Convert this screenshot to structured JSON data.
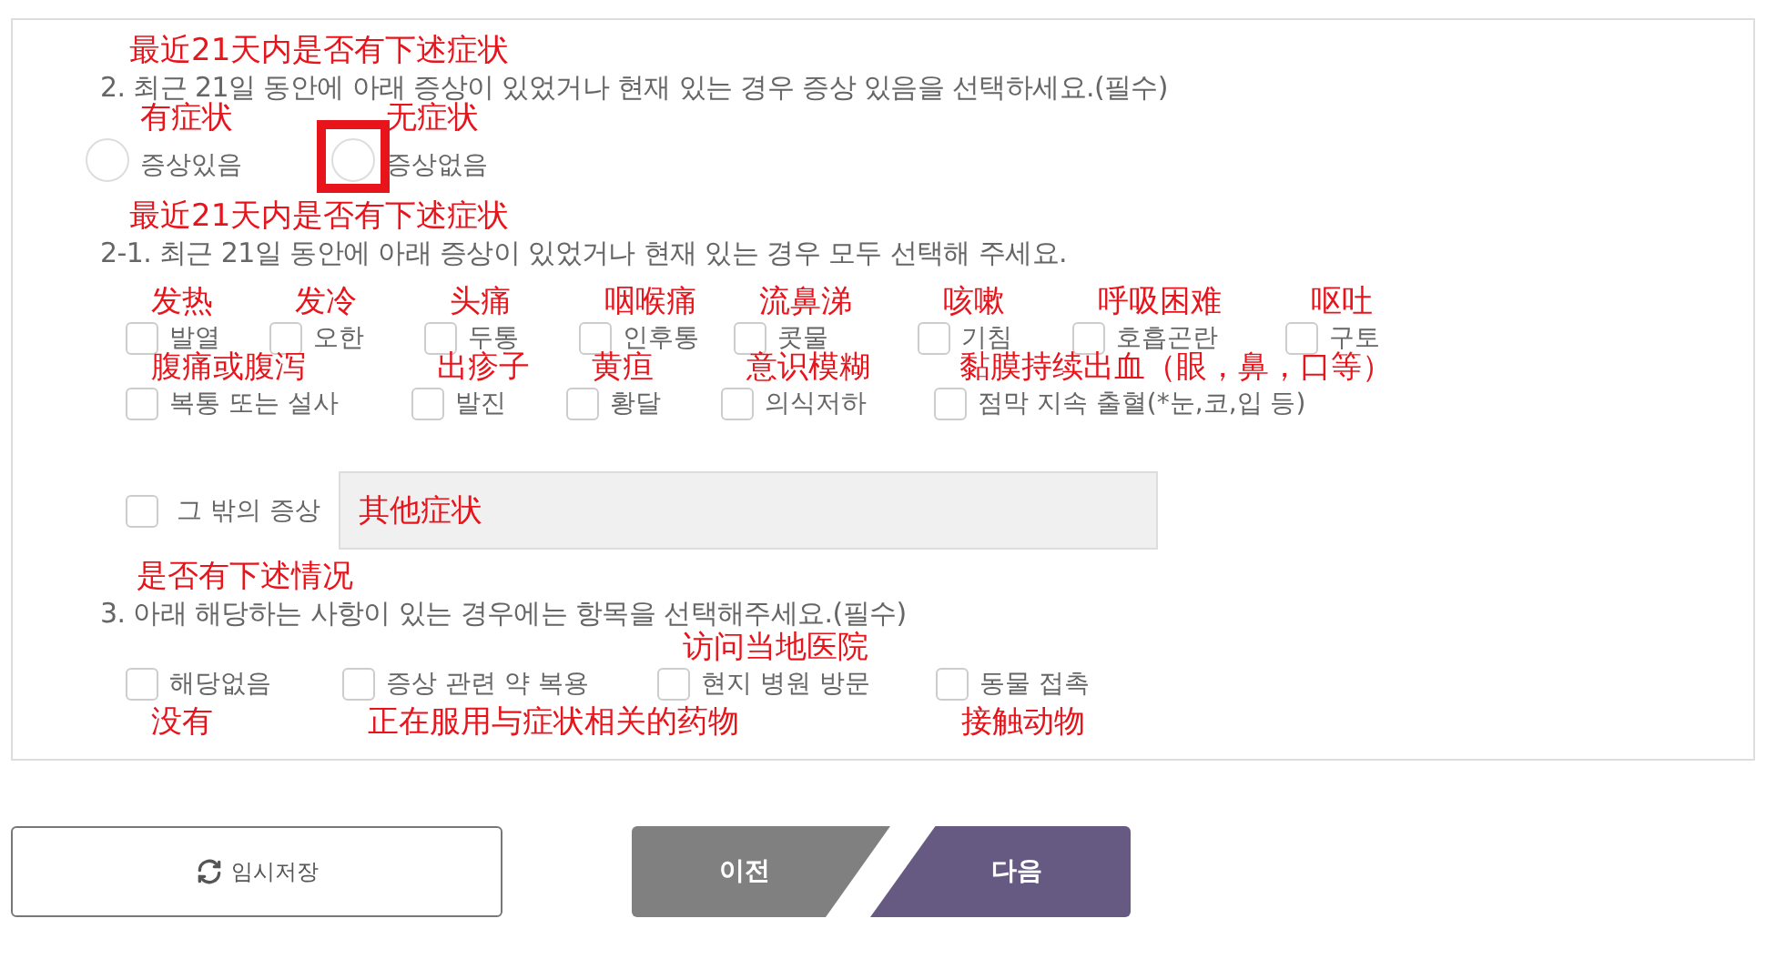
{
  "questions": [
    {
      "kind": "radio",
      "title": "2. 최근 21일 동안에 아래 증상이 있었거나 현재 있는 경우 증상 있음을 선택하세요.(필수)",
      "note": "最近21天内是否有下述症状",
      "lines": [
        {
          "options": [
            {
              "label": "증상있음",
              "note": "有症状",
              "selected": false,
              "highlighted": false
            },
            {
              "label": "증상없음",
              "note": "无症状",
              "selected": false,
              "highlighted": true
            }
          ]
        }
      ]
    },
    {
      "kind": "checkbox",
      "title": "2-1. 최근 21일 동안에 아래 증상이 있었거나 현재 있는 경우 모두 선택해 주세요.",
      "note": "最近21天内是否有下述症状",
      "lines": [
        {
          "options": [
            {
              "label": "발열",
              "note": "发热",
              "checked": false
            },
            {
              "label": "오한",
              "note": "发冷",
              "checked": false
            },
            {
              "label": "두통",
              "note": "头痛",
              "checked": false
            },
            {
              "label": "인후통",
              "note": "咽喉痛",
              "checked": false
            },
            {
              "label": "콧물",
              "note": "流鼻涕",
              "checked": false
            },
            {
              "label": "기침",
              "note": "咳嗽",
              "checked": false
            },
            {
              "label": "호흡곤란",
              "note": "呼吸困难",
              "checked": false
            },
            {
              "label": "구토",
              "note": "呕吐",
              "checked": false
            }
          ]
        },
        {
          "options": [
            {
              "label": "복통 또는 설사",
              "note": "腹痛或腹泻",
              "checked": false
            },
            {
              "label": "발진",
              "note": "出疹子",
              "checked": false
            },
            {
              "label": "황달",
              "note": "黄疸",
              "checked": false
            },
            {
              "label": "의식저하",
              "note": "意识模糊",
              "checked": false
            },
            {
              "label": "점막 지속 출혈(*눈,코,입 등)",
              "note": "黏膜持续出血（眼，鼻，口等）",
              "checked": false
            }
          ]
        }
      ],
      "other": {
        "label": "그 밖의 증상",
        "checked": false,
        "note": "其他症状"
      }
    },
    {
      "kind": "checkbox",
      "title": "3. 아래 해당하는 사항이 있는 경우에는 항목을 선택해주세요.(필수)",
      "note": "是否有下述情况",
      "lines": [
        {
          "options": [
            {
              "label": "해당없음",
              "note": "没有",
              "checked": false
            },
            {
              "label": "증상 관련 약 복용",
              "note": "正在服用与症状相关的药物",
              "checked": false
            },
            {
              "label": "현지 병원 방문",
              "note": "访问当地医院",
              "checked": false
            },
            {
              "label": "동물 접촉",
              "note": "接触动物",
              "checked": false
            }
          ]
        }
      ]
    }
  ],
  "buttons": {
    "save": "임시저장",
    "prev": "이전",
    "next": "다음"
  }
}
